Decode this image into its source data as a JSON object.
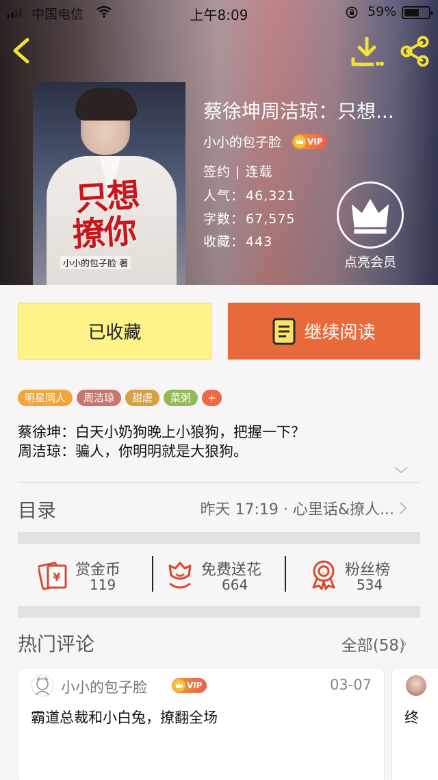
{
  "status_bar": {
    "carrier": "中国电信",
    "time": "上午8:09",
    "battery": "59%"
  },
  "book": {
    "title": "蔡徐坤周洁琼：只想...",
    "cover_title_line1": "只想",
    "cover_title_line2": "撩你",
    "cover_author": "小小的包子脸 著",
    "author": "小小的包子脸",
    "vip_label": "VIP",
    "status": "签约 | 连载",
    "popularity_label": "人气：",
    "popularity": "46,321",
    "words_label": "字数：",
    "words": "67,575",
    "favorites_label": "收藏：",
    "favorites": "443"
  },
  "member": {
    "label": "点亮会员"
  },
  "actions": {
    "collected": "已收藏",
    "continue_reading": "继续阅读"
  },
  "tags": [
    {
      "label": "明星同人",
      "color": "#f1a53d"
    },
    {
      "label": "周洁琼",
      "color": "#c7776d"
    },
    {
      "label": "甜虐",
      "color": "#d8a043"
    },
    {
      "label": "菜粥",
      "color": "#93ba5a"
    },
    {
      "label": "+",
      "color": "#ec6a4a"
    }
  ],
  "intro": "蔡徐坤：白天小奶狗晚上小狼狗，把握一下？\n周洁琼：骗人，你明明就是大狼狗。",
  "toc": {
    "title": "目录",
    "latest": "昨天 17:19 · 心里话&撩人..."
  },
  "stats": [
    {
      "label": "赏金币",
      "value": "119"
    },
    {
      "label": "免费送花",
      "value": "664"
    },
    {
      "label": "粉丝榜",
      "value": "534"
    }
  ],
  "comments": {
    "title": "热门评论",
    "all": "全部(58)",
    "items": [
      {
        "author": "小小的包子脸",
        "vip": "VIP",
        "date": "03-07",
        "text": "霸道总裁和小白兔，撩翻全场"
      },
      {
        "text": "终"
      }
    ]
  },
  "colors": {
    "accent_orange": "#e8693a",
    "collected_yellow": "#fdf389",
    "icon_red": "#d9472f",
    "header_icon_yellow": "#f3e03b"
  }
}
